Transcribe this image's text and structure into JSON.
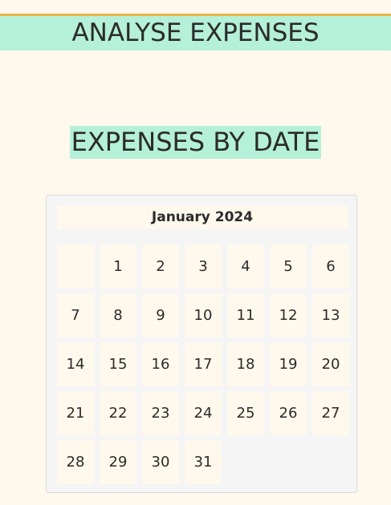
{
  "header": {
    "title": "ANALYSE EXPENSES"
  },
  "section": {
    "title": "EXPENSES BY DATE"
  },
  "calendar": {
    "month_label": "January 2024",
    "leading_blanks": 1,
    "days": [
      "1",
      "2",
      "3",
      "4",
      "5",
      "6",
      "7",
      "8",
      "9",
      "10",
      "11",
      "12",
      "13",
      "14",
      "15",
      "16",
      "17",
      "18",
      "19",
      "20",
      "21",
      "22",
      "23",
      "24",
      "25",
      "26",
      "27",
      "28",
      "29",
      "30",
      "31"
    ]
  },
  "colors": {
    "background": "#fff8ec",
    "accent_mint": "#b5f0d8",
    "accent_gold": "#e8b547",
    "calendar_bg": "#f5f5f5",
    "text": "#2b2b2b"
  }
}
